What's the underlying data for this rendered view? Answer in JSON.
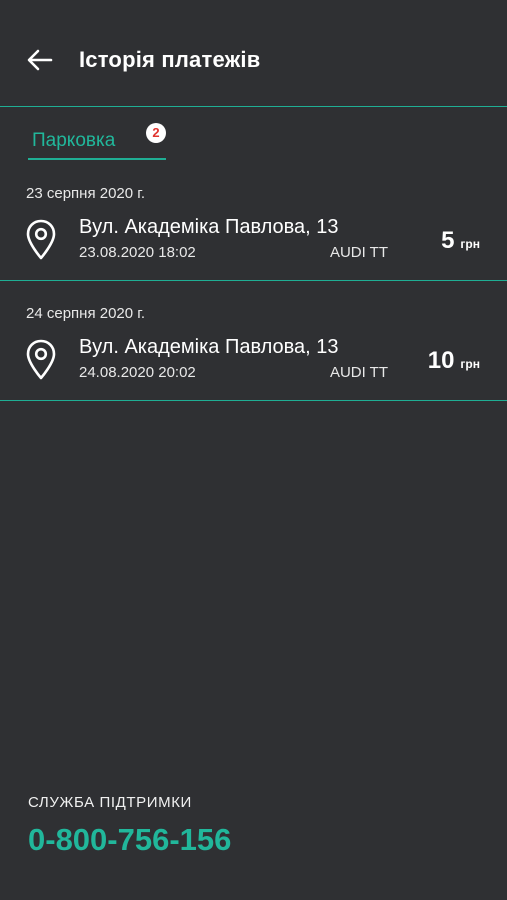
{
  "header": {
    "title": "Історія платежів",
    "back_icon": "arrow-left-icon"
  },
  "tabs": [
    {
      "label": "Парковка",
      "badge": "2",
      "active": true
    }
  ],
  "payments": [
    {
      "date_header": "23 серпня 2020 г.",
      "icon": "location-pin-icon",
      "address": "Вул. Академіка Павлова, 13",
      "datetime": "23.08.2020 18:02",
      "car": "AUDI TT",
      "amount": "5",
      "currency": "грн"
    },
    {
      "date_header": "24 серпня 2020 г.",
      "icon": "location-pin-icon",
      "address": "Вул. Академіка Павлова, 13",
      "datetime": "24.08.2020 20:02",
      "car": "AUDI TT",
      "amount": "10",
      "currency": "грн"
    }
  ],
  "support": {
    "label": "СЛУЖБА ПІДТРИМКИ",
    "phone": "0-800-756-156"
  },
  "colors": {
    "background": "#2f3033",
    "accent": "#21b79b",
    "badge_text": "#e0342f"
  }
}
